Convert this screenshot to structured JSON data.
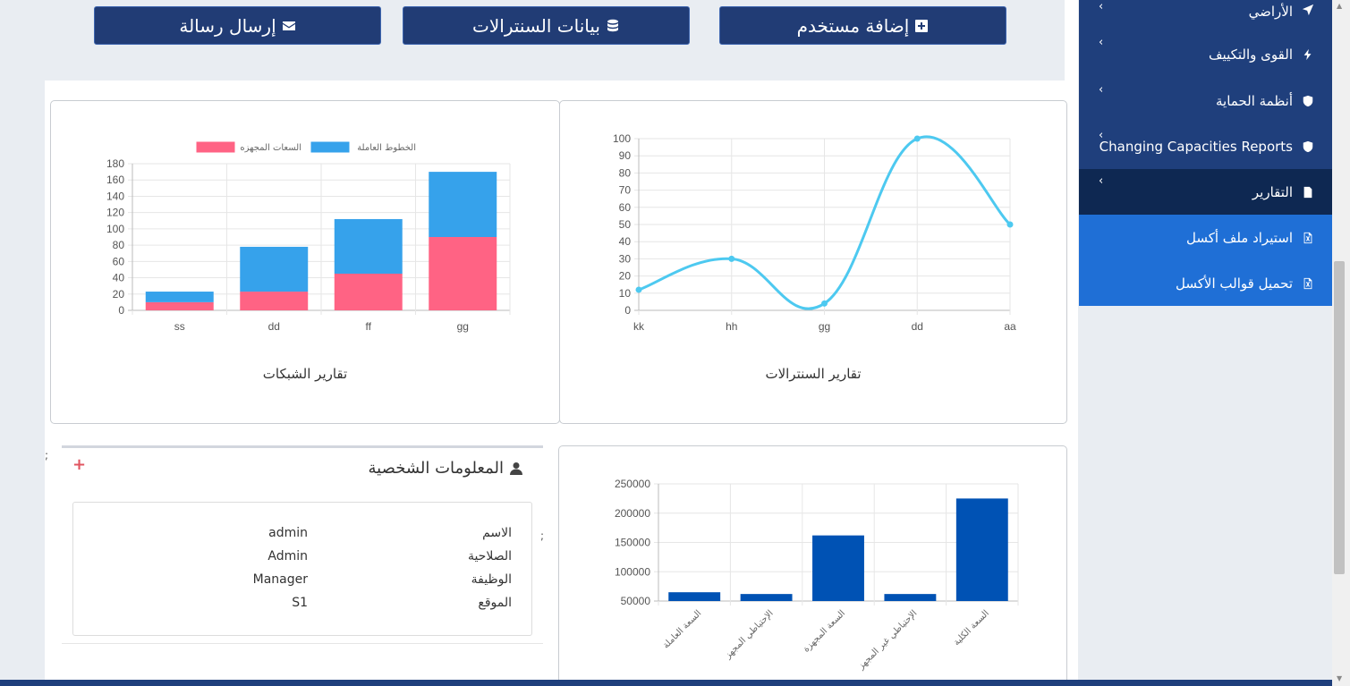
{
  "topbar": {
    "buttons": [
      {
        "label": "إرسال رسالة",
        "icon": "envelope-icon"
      },
      {
        "label": "بيانات السنترالات",
        "icon": "database-icon"
      },
      {
        "label": "إضافة مستخدم",
        "icon": "plus-square-icon"
      }
    ]
  },
  "sidebar": {
    "items": [
      {
        "label": "الأراضي",
        "icon": "location-arrow-icon"
      },
      {
        "label": "القوى والتكييف",
        "icon": "bolt-icon"
      },
      {
        "label": "أنظمة الحماية",
        "icon": "shield-icon"
      },
      {
        "label": "Changing Capacities Reports",
        "icon": "shield-icon"
      },
      {
        "label": "التقارير",
        "icon": "file-icon"
      },
      {
        "label": "استيراد ملف أكسل",
        "icon": "excel-file-icon"
      },
      {
        "label": "تحميل قوالب الأكسل",
        "icon": "excel-file-icon"
      }
    ]
  },
  "charts": {
    "networks_title": "تقارير الشبكات",
    "exchanges_title": "تقارير السنترالات"
  },
  "chart_data": [
    {
      "type": "bar",
      "stacked": true,
      "categories": [
        "ss",
        "dd",
        "ff",
        "gg"
      ],
      "series": [
        {
          "name": "الخطوط العاملة",
          "values": [
            13,
            55,
            67,
            80
          ],
          "color": "#36a2eb"
        },
        {
          "name": "السعات المجهزه",
          "values": [
            10,
            23,
            45,
            90
          ],
          "color": "#ff6384"
        }
      ],
      "legend": [
        "الخطوط العاملة",
        "السعات المجهزه"
      ],
      "ylim": [
        0,
        180
      ],
      "yticks": [
        0,
        20,
        40,
        60,
        80,
        100,
        120,
        140,
        160,
        180
      ],
      "title": "تقارير الشبكات",
      "grid": true,
      "legend_position": "top"
    },
    {
      "type": "line",
      "categories": [
        "kk",
        "hh",
        "gg",
        "dd",
        "aa"
      ],
      "values": [
        12,
        30,
        4,
        100,
        50
      ],
      "color": "#4dc9f0",
      "ylim": [
        0,
        100
      ],
      "yticks": [
        0,
        10,
        20,
        30,
        40,
        50,
        60,
        70,
        80,
        90,
        100
      ],
      "title": "تقارير السنترالات",
      "grid": true
    },
    {
      "type": "bar",
      "categories": [
        "السعة العاملة",
        "الإحتياطي المجهز",
        "السعة المجهزة",
        "الإحتياطي غير المجهز",
        "السعة الكلية"
      ],
      "values": [
        65000,
        62000,
        162000,
        62000,
        225000
      ],
      "color": "#0052b4",
      "ylim": [
        50000,
        250000
      ],
      "yticks": [
        50000,
        100000,
        150000,
        200000,
        250000
      ],
      "grid": true
    }
  ],
  "profile": {
    "title": "المعلومات الشخصية",
    "plus_symbol": "+",
    "fields": [
      {
        "key": "الاسم",
        "value": "admin"
      },
      {
        "key": "الصلاحية",
        "value": "Admin"
      },
      {
        "key": "الوظيفة",
        "value": "Manager"
      },
      {
        "key": "الموقع",
        "value": "S1"
      }
    ]
  },
  "misc": {
    "semicolon": ";"
  }
}
